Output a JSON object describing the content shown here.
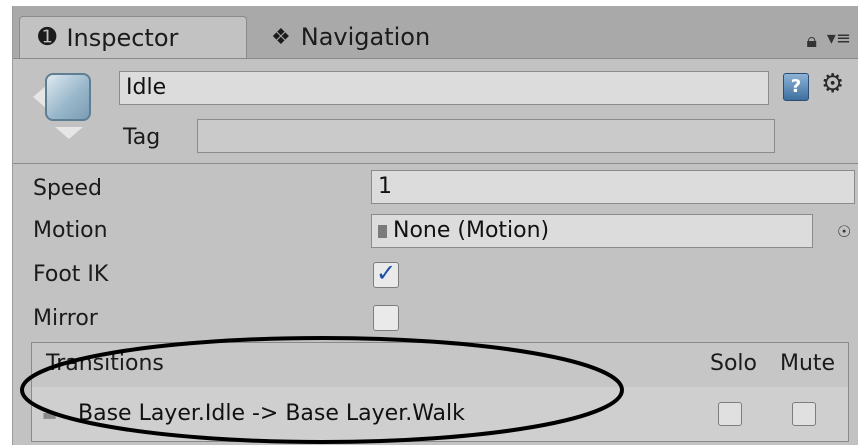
{
  "tabs": [
    {
      "icon": "info-icon",
      "label": "Inspector",
      "active": true
    },
    {
      "icon": "navigation-icon",
      "label": "Navigation",
      "active": false
    }
  ],
  "header": {
    "name_value": "Idle",
    "tag_label": "Tag",
    "tag_value": ""
  },
  "properties": {
    "speed_label": "Speed",
    "speed_value": "1",
    "motion_label": "Motion",
    "motion_value": "None (Motion)",
    "foot_ik_label": "Foot IK",
    "foot_ik_checked": true,
    "mirror_label": "Mirror",
    "mirror_checked": false
  },
  "transitions": {
    "title": "Transitions",
    "col_solo": "Solo",
    "col_mute": "Mute",
    "rows": [
      {
        "label": "Base Layer.Idle -> Base Layer.Walk",
        "solo": false,
        "mute": false
      }
    ]
  },
  "annotation": {
    "shape": "ellipse",
    "color": "#000000"
  }
}
